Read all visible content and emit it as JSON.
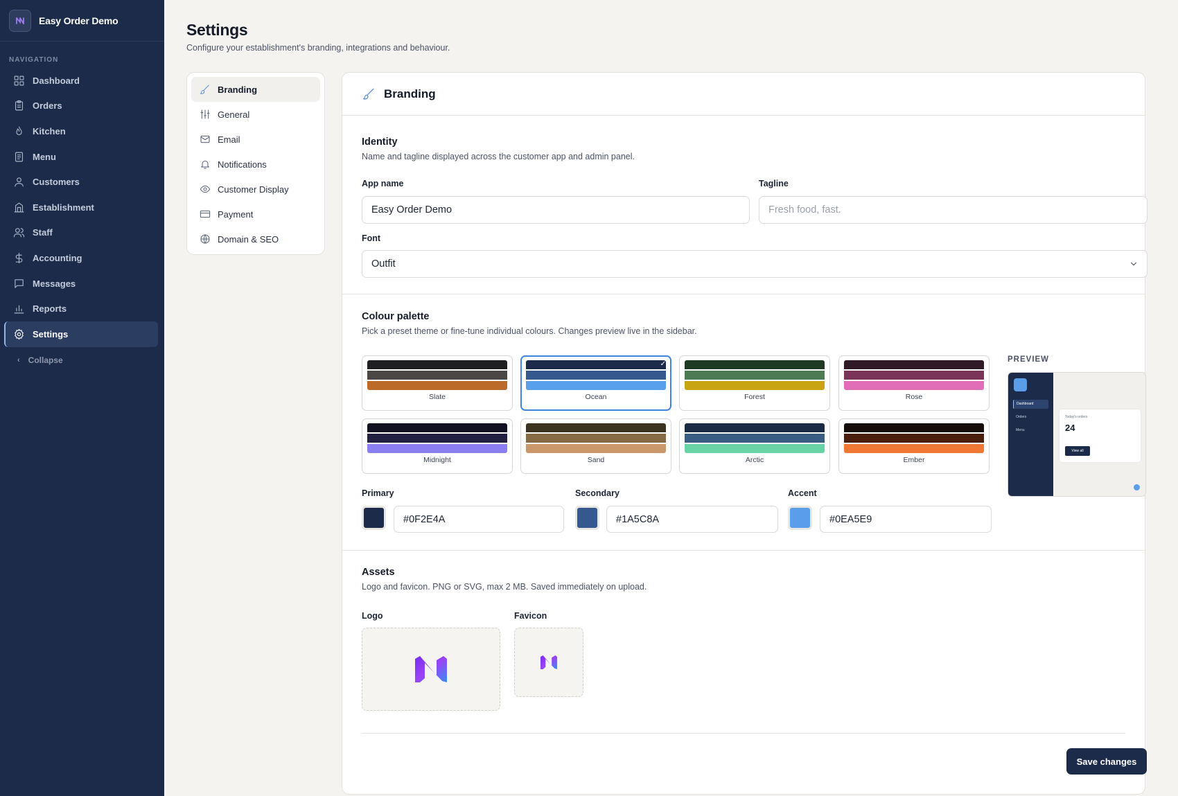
{
  "app": {
    "name": "Easy Order Demo"
  },
  "sidebar": {
    "heading": "NAVIGATION",
    "items": [
      {
        "label": "Dashboard",
        "icon": "grid-icon",
        "active": false
      },
      {
        "label": "Orders",
        "icon": "clipboard-icon",
        "active": false
      },
      {
        "label": "Kitchen",
        "icon": "flame-icon",
        "active": false
      },
      {
        "label": "Menu",
        "icon": "book-icon",
        "active": false
      },
      {
        "label": "Customers",
        "icon": "user-icon",
        "active": false
      },
      {
        "label": "Establishment",
        "icon": "building-icon",
        "active": false
      },
      {
        "label": "Staff",
        "icon": "users-icon",
        "active": false
      },
      {
        "label": "Accounting",
        "icon": "dollar-icon",
        "active": false
      },
      {
        "label": "Messages",
        "icon": "message-icon",
        "active": false
      },
      {
        "label": "Reports",
        "icon": "bar-chart-icon",
        "active": false
      },
      {
        "label": "Settings",
        "icon": "gear-icon",
        "active": true
      }
    ],
    "collapse_label": "Collapse"
  },
  "header": {
    "title": "Settings",
    "subtitle": "Configure your establishment's branding, integrations and behaviour."
  },
  "subnav": {
    "items": [
      {
        "label": "Branding",
        "icon": "brush-icon",
        "active": true
      },
      {
        "label": "General",
        "icon": "sliders-icon",
        "active": false
      },
      {
        "label": "Email",
        "icon": "mail-icon",
        "active": false
      },
      {
        "label": "Notifications",
        "icon": "bell-icon",
        "active": false
      },
      {
        "label": "Customer Display",
        "icon": "eye-icon",
        "active": false
      },
      {
        "label": "Payment",
        "icon": "card-icon",
        "active": false
      },
      {
        "label": "Domain & SEO",
        "icon": "globe-icon",
        "active": false
      }
    ]
  },
  "card": {
    "title": "Branding"
  },
  "identity": {
    "title": "Identity",
    "description": "Name and tagline displayed across the customer app and admin panel.",
    "app_name_label": "App name",
    "app_name_value": "Easy Order Demo",
    "tagline_label": "Tagline",
    "tagline_value": "",
    "tagline_placeholder": "Fresh food, fast.",
    "font_label": "Font",
    "font_value": "Outfit"
  },
  "palette": {
    "title": "Colour palette",
    "description": "Pick a preset theme or fine-tune individual colours. Changes preview live in the sidebar.",
    "themes": [
      {
        "name": "Slate",
        "colors": [
          "#1f1f22",
          "#4a4744",
          "#bb6a2a"
        ],
        "selected": false
      },
      {
        "name": "Ocean",
        "colors": [
          "#1c2b4a",
          "#35588f",
          "#59a0ea"
        ],
        "selected": true
      },
      {
        "name": "Forest",
        "colors": [
          "#1f3a22",
          "#4d7a52",
          "#c9a412"
        ],
        "selected": false
      },
      {
        "name": "Rose",
        "colors": [
          "#311a27",
          "#7a3458",
          "#e06fb8"
        ],
        "selected": false
      },
      {
        "name": "Midnight",
        "colors": [
          "#121121",
          "#232141",
          "#8b7ef0"
        ],
        "selected": false
      },
      {
        "name": "Sand",
        "colors": [
          "#3c3220",
          "#856a44",
          "#c9976a"
        ],
        "selected": false
      },
      {
        "name": "Arctic",
        "colors": [
          "#1b2b45",
          "#3a5e82",
          "#6ad3a6"
        ],
        "selected": false
      },
      {
        "name": "Ember",
        "colors": [
          "#140d0a",
          "#4a1e0d",
          "#ee7834"
        ],
        "selected": false
      }
    ],
    "primary_label": "Primary",
    "primary_value": "#0F2E4A",
    "primary_swatch": "#1c2b4a",
    "secondary_label": "Secondary",
    "secondary_value": "#1A5C8A",
    "secondary_swatch": "#35588f",
    "accent_label": "Accent",
    "accent_value": "#0EA5E9",
    "accent_swatch": "#5a9eea",
    "preview": {
      "label": "PREVIEW",
      "nav_items": [
        "Dashboard",
        "Orders",
        "Menu"
      ],
      "card_caption": "Today's orders",
      "card_value": "24",
      "button_label": "View all"
    }
  },
  "assets": {
    "title": "Assets",
    "description": "Logo and favicon. PNG or SVG, max 2 MB. Saved immediately on upload.",
    "logo_label": "Logo",
    "favicon_label": "Favicon"
  },
  "actions": {
    "save_label": "Save changes"
  }
}
